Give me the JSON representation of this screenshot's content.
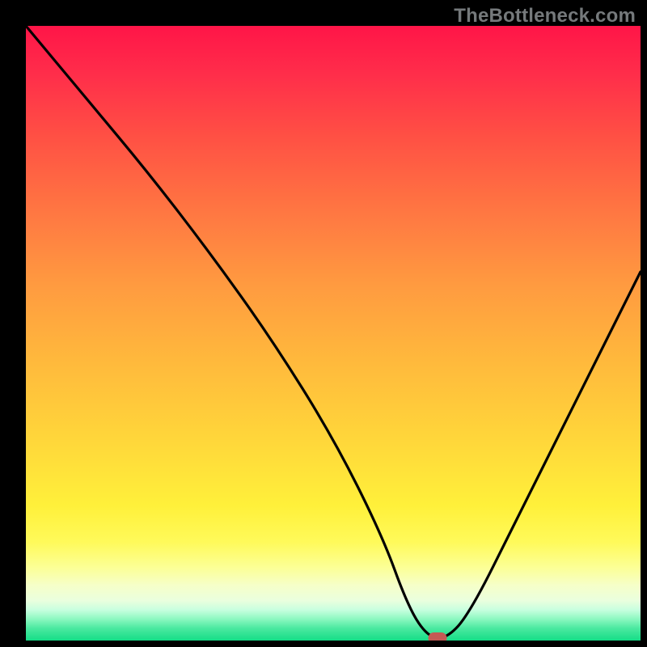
{
  "watermark": "TheBottleneck.com",
  "chart_data": {
    "type": "line",
    "title": "",
    "xlabel": "",
    "ylabel": "",
    "xlim": [
      0,
      100
    ],
    "ylim": [
      0,
      100
    ],
    "grid": false,
    "legend": false,
    "background": "rainbow-gradient vertical (red top → yellow mid → green bottom)",
    "series": [
      {
        "name": "bottleneck-curve",
        "x": [
          0,
          10,
          20,
          30,
          40,
          50,
          58,
          62,
          65,
          68,
          72,
          80,
          90,
          100
        ],
        "y": [
          100,
          88,
          76,
          63,
          49,
          33,
          17,
          6,
          1,
          0,
          4,
          20,
          40,
          60
        ]
      }
    ],
    "marker": {
      "x": 67,
      "y": 0,
      "color": "#c55a54",
      "shape": "rounded-rect"
    },
    "note": "y is distance above bottom edge as percent of plot height; curve is a V shape with minimum near x≈67"
  },
  "colors": {
    "frame": "#000000",
    "watermark": "#75797b",
    "curve": "#000000",
    "marker": "#c55a54"
  }
}
